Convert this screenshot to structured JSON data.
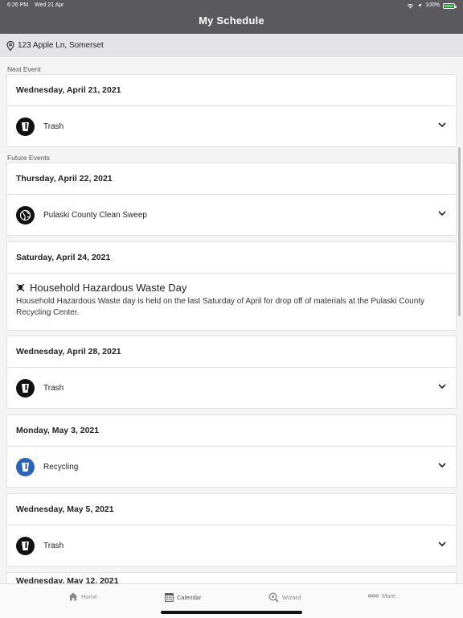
{
  "status": {
    "time": "6:26 PM",
    "date": "Wed 21 Apr",
    "battery": "100%",
    "battery_level": 1.0
  },
  "header": {
    "title": "My Schedule"
  },
  "location": {
    "address": "123 Apple Ln, Somerset"
  },
  "sections": {
    "next_label": "Next Event",
    "future_label": "Future Events"
  },
  "events": [
    {
      "date": "Wednesday, April 21, 2021",
      "item": "Trash",
      "icon": "trash-bin-icon"
    },
    {
      "date": "Thursday, April 22, 2021",
      "item": "Pulaski County Clean Sweep",
      "icon": "globe-icon"
    },
    {
      "date": "Saturday, April 24, 2021",
      "item": "Household Hazardous Waste Day",
      "description": "Household Hazardous Waste day is held on the last Saturday of April for drop off of materials at the Pulaski County Recycling Center.",
      "icon": "skull-crossbones-icon"
    },
    {
      "date": "Wednesday, April 28, 2021",
      "item": "Trash",
      "icon": "trash-bin-icon"
    },
    {
      "date": "Monday, May 3, 2021",
      "item": "Recycling",
      "icon": "recycling-bin-icon",
      "color": "#2c64b5"
    },
    {
      "date": "Wednesday, May 5, 2021",
      "item": "Trash",
      "icon": "trash-bin-icon"
    },
    {
      "date": "Wednesday, May 12, 2021"
    }
  ],
  "tabs": [
    {
      "label": "Home",
      "icon": "home-icon"
    },
    {
      "label": "Calendar",
      "icon": "calendar-icon",
      "active": true
    },
    {
      "label": "Wizard",
      "icon": "magnifier-icon"
    },
    {
      "label": "More",
      "icon": "more-dots-icon"
    }
  ]
}
